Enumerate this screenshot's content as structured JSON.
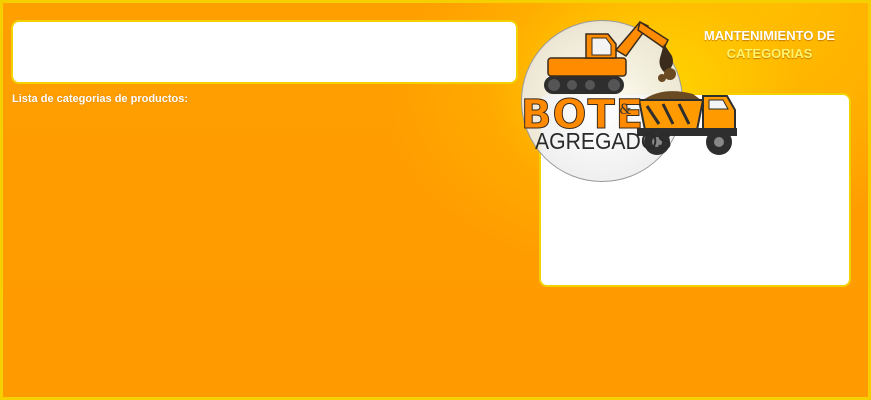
{
  "header": {
    "title_line1": "MANTENIMIENTO DE",
    "title_line2": "CATEGORIAS"
  },
  "main": {
    "list_label": "Lista de categorias de productos:"
  },
  "logo": {
    "word1": "BOTE",
    "ampersand": "&",
    "word2": "AGREGADOS"
  },
  "colors": {
    "background": "#ff9f00",
    "border": "#f6cf00",
    "accent_yellow": "#fff36a",
    "logo_orange": "#ff8a00"
  }
}
